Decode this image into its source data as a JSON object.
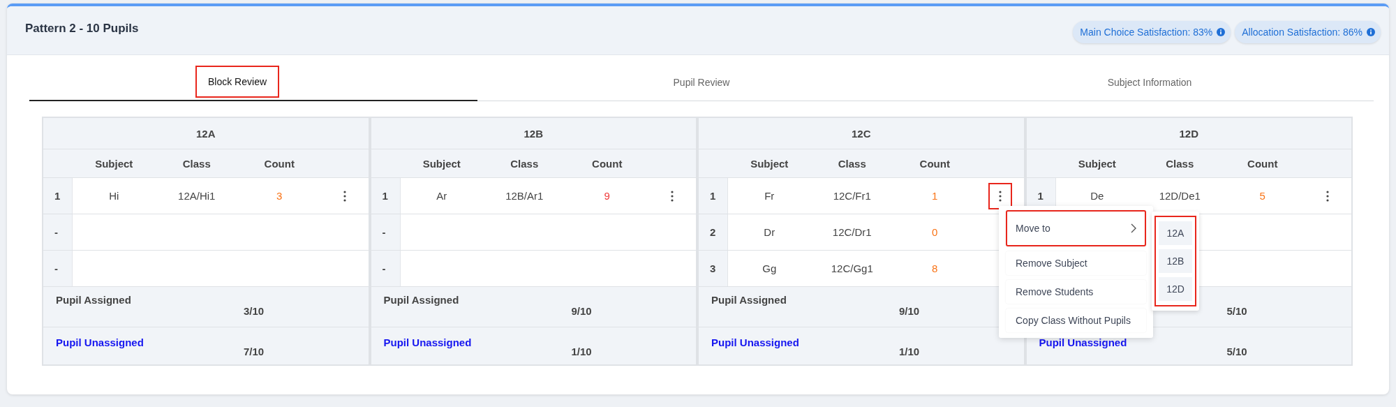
{
  "header": {
    "title": "Pattern 2 - 10 Pupils",
    "badges": [
      {
        "label": "Main Choice Satisfaction: 83%"
      },
      {
        "label": "Allocation Satisfaction: 86%"
      }
    ]
  },
  "tabs": [
    {
      "label": "Block Review",
      "selected": true,
      "highlighted": true
    },
    {
      "label": "Pupil Review",
      "selected": false,
      "highlighted": false
    },
    {
      "label": "Subject Information",
      "selected": false,
      "highlighted": false
    }
  ],
  "blocks": [
    {
      "name": "12A",
      "columns": [
        "Subject",
        "Class",
        "Count"
      ],
      "rows": [
        {
          "index": "1",
          "subject": "Hi",
          "class": "12A/Hi1",
          "count": "3",
          "color": "#f97316",
          "menu_button": true,
          "highlighted": false
        },
        {
          "index": "-"
        },
        {
          "index": "-"
        }
      ],
      "assigned": {
        "label": "Pupil Assigned",
        "value": "3/10"
      },
      "unassigned": {
        "label": "Pupil Unassigned",
        "value": "7/10"
      }
    },
    {
      "name": "12B",
      "columns": [
        "Subject",
        "Class",
        "Count"
      ],
      "rows": [
        {
          "index": "1",
          "subject": "Ar",
          "class": "12B/Ar1",
          "count": "9",
          "color": "#ef3b3b",
          "menu_button": true,
          "highlighted": false
        },
        {
          "index": "-"
        },
        {
          "index": "-"
        }
      ],
      "assigned": {
        "label": "Pupil Assigned",
        "value": "9/10"
      },
      "unassigned": {
        "label": "Pupil Unassigned",
        "value": "1/10"
      }
    },
    {
      "name": "12C",
      "columns": [
        "Subject",
        "Class",
        "Count"
      ],
      "rows": [
        {
          "index": "1",
          "subject": "Fr",
          "class": "12C/Fr1",
          "count": "1",
          "color": "#f97316",
          "menu_button": true,
          "highlighted": true
        },
        {
          "index": "2",
          "subject": "Dr",
          "class": "12C/Dr1",
          "count": "0",
          "color": "#f97316",
          "menu_button": false
        },
        {
          "index": "3",
          "subject": "Gg",
          "class": "12C/Gg1",
          "count": "8",
          "color": "#f97316",
          "menu_button": false
        }
      ],
      "assigned": {
        "label": "Pupil Assigned",
        "value": "9/10"
      },
      "unassigned": {
        "label": "Pupil Unassigned",
        "value": "1/10"
      }
    },
    {
      "name": "12D",
      "columns": [
        "Subject",
        "Class",
        "Count"
      ],
      "rows": [
        {
          "index": "1",
          "subject": "De",
          "class": "12D/De1",
          "count": "5",
          "color": "#f97316",
          "menu_button": true,
          "highlighted": false
        },
        {},
        {}
      ],
      "assigned": {
        "value": "5/10"
      },
      "unassigned": {
        "label": "Pupil Unassigned",
        "value": "5/10"
      }
    }
  ],
  "menu": {
    "items": [
      {
        "label": "Move to",
        "submenu": true,
        "highlighted": true
      },
      {
        "label": "Remove Subject",
        "submenu": false,
        "highlighted": false
      },
      {
        "label": "Remove Students",
        "submenu": false,
        "highlighted": false
      },
      {
        "label": "Copy Class Without Pupils",
        "submenu": false,
        "highlighted": false
      }
    ],
    "submenu": {
      "highlighted": true,
      "items": [
        {
          "label": "12A"
        },
        {
          "label": "12B"
        },
        {
          "label": "12D"
        }
      ]
    }
  }
}
